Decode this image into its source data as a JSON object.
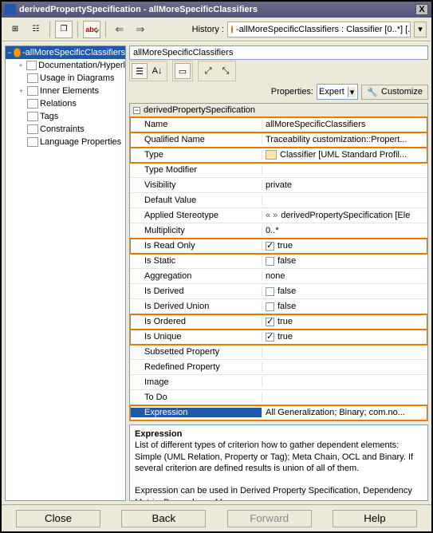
{
  "window": {
    "title": "derivedPropertySpecification - allMoreSpecificClassifiers",
    "close_glyph": "X"
  },
  "toolbar": {
    "history_label": "History :",
    "history_value": "-allMoreSpecificClassifiers : Classifier [0..*] [...",
    "abc_label": "abc",
    "arrow_back": "⇐",
    "arrow_fwd": "⇒"
  },
  "tree": {
    "items": [
      {
        "label": "-allMoreSpecificClassifiers",
        "selected": true,
        "expand": "−",
        "icon": "orange"
      },
      {
        "label": "Documentation/Hyperl",
        "expand": "+",
        "icon": "page"
      },
      {
        "label": "Usage in Diagrams",
        "expand": "",
        "icon": "page"
      },
      {
        "label": "Inner Elements",
        "expand": "+",
        "icon": "page"
      },
      {
        "label": "Relations",
        "expand": "",
        "icon": "page"
      },
      {
        "label": "Tags",
        "expand": "",
        "icon": "page"
      },
      {
        "label": "Constraints",
        "expand": "",
        "icon": "page"
      },
      {
        "label": "Language Properties",
        "expand": "",
        "icon": "page"
      }
    ]
  },
  "right": {
    "header": "allMoreSpecificClassifiers",
    "properties_label": "Properties:",
    "mode": "Expert",
    "customize_label": "Customize",
    "section_title": "derivedPropertySpecification"
  },
  "props": [
    {
      "name": "Name",
      "value": "allMoreSpecificClassifiers",
      "hl": true
    },
    {
      "name": "Qualified Name",
      "value": "Traceability customization::Propert...",
      "hl": true
    },
    {
      "name": "Type",
      "value": "Classifier [UML Standard Profil...",
      "hl": true,
      "icon": "type"
    },
    {
      "name": "Type Modifier",
      "value": ""
    },
    {
      "name": "Visibility",
      "value": "private"
    },
    {
      "name": "Default Value",
      "value": ""
    },
    {
      "name": "Applied Stereotype",
      "value": "derivedPropertySpecification [Ele",
      "stereo": true
    },
    {
      "name": "Multiplicity",
      "value": "0..*"
    },
    {
      "name": "Is Read Only",
      "value": "true",
      "check": true,
      "checked": true,
      "hl": true
    },
    {
      "name": "Is Static",
      "value": "false",
      "check": true,
      "checked": false
    },
    {
      "name": "Aggregation",
      "value": "none"
    },
    {
      "name": "Is Derived",
      "value": "false",
      "check": true,
      "checked": false
    },
    {
      "name": "Is Derived Union",
      "value": "false",
      "check": true,
      "checked": false
    },
    {
      "name": "Is Ordered",
      "value": "true",
      "check": true,
      "checked": true,
      "hl": true
    },
    {
      "name": "Is Unique",
      "value": "true",
      "check": true,
      "checked": true,
      "hl": true
    },
    {
      "name": "Subsetted Property",
      "value": ""
    },
    {
      "name": "Redefined Property",
      "value": ""
    },
    {
      "name": "Image",
      "value": ""
    },
    {
      "name": "To Do",
      "value": ""
    },
    {
      "name": "Expression",
      "value": "All Generalization; Binary; com.no...",
      "hl": true,
      "sel": true
    }
  ],
  "desc": {
    "title": "Expression",
    "body1": "List of different types of criterion how to gather dependent elements: Simple (UML Relation, Property or Tag); Meta Chain, OCL and Binary. If several criterion are defined results is union of all of them.",
    "body2": "Expression can be used in Derived Property Specification, Dependency Matrix, Dependency Map."
  },
  "buttons": {
    "close": "Close",
    "back": "Back",
    "forward": "Forward",
    "help": "Help"
  }
}
